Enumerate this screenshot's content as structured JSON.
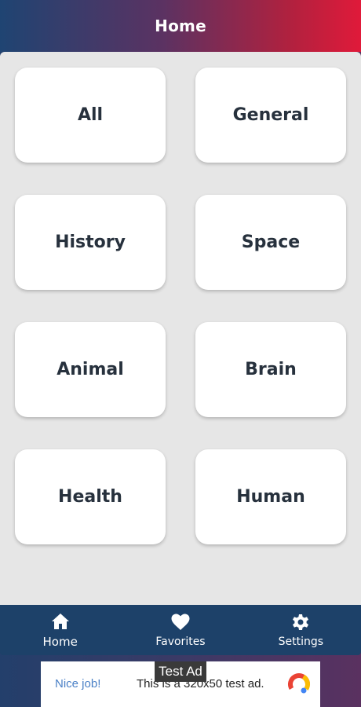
{
  "header": {
    "title": "Home"
  },
  "categories": [
    {
      "label": "All"
    },
    {
      "label": "General"
    },
    {
      "label": "History"
    },
    {
      "label": "Space"
    },
    {
      "label": "Animal"
    },
    {
      "label": "Brain"
    },
    {
      "label": "Health"
    },
    {
      "label": "Human"
    }
  ],
  "bottom_nav": {
    "items": [
      {
        "label": "Home",
        "icon": "home-icon",
        "active": true
      },
      {
        "label": "Favorites",
        "icon": "heart-icon",
        "active": false
      },
      {
        "label": "Settings",
        "icon": "gear-icon",
        "active": false
      }
    ]
  },
  "ad": {
    "tag": "Test Ad",
    "cta": "Nice job!",
    "text": "This is a 320x50 test ad."
  },
  "colors": {
    "header_start": "#1f4472",
    "header_end": "#e01a3a",
    "nav_background": "#1d4169",
    "card_text": "#27313d",
    "content_background": "#e6e6e6"
  }
}
